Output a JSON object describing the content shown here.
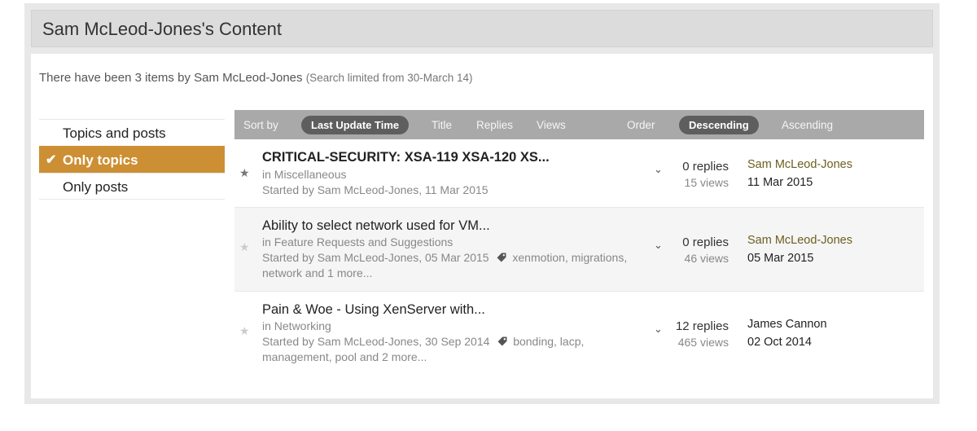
{
  "page": {
    "title": "Sam McLeod-Jones's Content",
    "summary": "There have been 3 items by Sam McLeod-Jones",
    "summary_note": "(Search limited from 30-March 14)"
  },
  "filters": [
    {
      "label": "Topics and posts",
      "active": false
    },
    {
      "label": "Only topics",
      "active": true
    },
    {
      "label": "Only posts",
      "active": false
    }
  ],
  "sort": {
    "sort_by_label": "Sort by",
    "options": [
      "Last Update Time",
      "Title",
      "Replies",
      "Views"
    ],
    "selected": "Last Update Time",
    "order_label": "Order",
    "order_options": [
      "Descending",
      "Ascending"
    ],
    "order_selected": "Descending"
  },
  "topics": [
    {
      "title": "CRITICAL-SECURITY: XSA-119 XSA-120 XS...",
      "bold": true,
      "forum": "in Miscellaneous",
      "started": "Started by Sam McLeod-Jones, 11 Mar 2015",
      "tags": "",
      "tags_more": "",
      "replies": "0 replies",
      "views": "15 views",
      "last_user": "Sam McLeod-Jones",
      "last_date": "11 Mar 2015",
      "starred": true
    },
    {
      "title": "Ability to select network used for VM...",
      "bold": false,
      "forum": "in Feature Requests and Suggestions",
      "started": "Started by Sam McLeod-Jones, 05 Mar 2015",
      "tags": "xenmotion, migrations,",
      "tags_more": "network and 1 more...",
      "replies": "0 replies",
      "views": "46 views",
      "last_user": "Sam McLeod-Jones",
      "last_date": "05 Mar 2015",
      "starred": false
    },
    {
      "title": "Pain & Woe - Using XenServer with...",
      "bold": false,
      "forum": "in Networking",
      "started": "Started by Sam McLeod-Jones, 30 Sep 2014",
      "tags": "bonding, lacp,",
      "tags_more": "management, pool and 2 more...",
      "replies": "12 replies",
      "views": "465 views",
      "last_user": "James Cannon",
      "last_date": "02 Oct 2014",
      "starred": false
    }
  ],
  "colors": {
    "accent": "#cd8f33",
    "sortbar": "#a9a9a9",
    "pill": "#5e5e5e",
    "username": "#6c5f1f"
  },
  "icons": {
    "check": "check-icon",
    "star": "star-icon",
    "tag": "tag-icon",
    "chevron": "chevron-down-icon"
  }
}
